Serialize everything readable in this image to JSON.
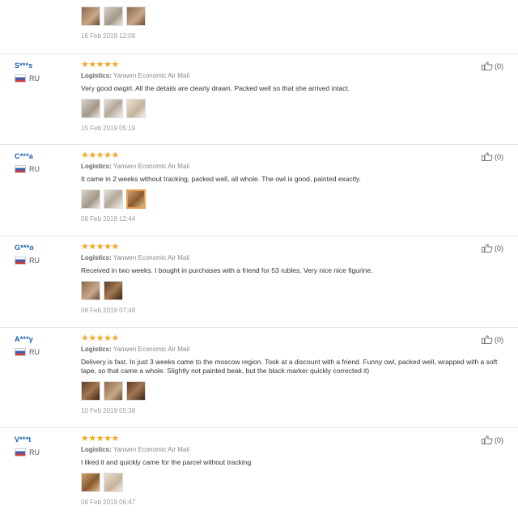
{
  "reviews": [
    {
      "user": "",
      "country": "",
      "logistics_label": "",
      "logistics_value": "",
      "text": "",
      "photos": [
        "ph-a",
        "ph-b",
        "ph-a"
      ],
      "date": "16 Feb 2019 12:09",
      "helpful": "",
      "partial": true
    },
    {
      "user": "S***s",
      "country": "RU",
      "logistics_label": "Logistics:",
      "logistics_value": "Yanwen Economic Air Mail",
      "text": "Very good owgirl. All the details are clearly drawn. Packed well so that she arrived intact.",
      "photos": [
        "ph-b",
        "ph-c",
        "ph-f"
      ],
      "date": "15 Feb 2019 05:19",
      "helpful": "(0)"
    },
    {
      "user": "C***a",
      "country": "RU",
      "logistics_label": "Logistics:",
      "logistics_value": "Yanwen Economic Air Mail",
      "text": "It came in 2 weeks without tracking, packed well, all whole. The owl is good, painted exactly.",
      "photos": [
        "ph-b",
        "ph-c",
        "ph-d"
      ],
      "selected_photo": 2,
      "date": "08 Feb 2019 12:44",
      "helpful": "(0)"
    },
    {
      "user": "G***o",
      "country": "RU",
      "logistics_label": "Logistics:",
      "logistics_value": "Yanwen Economic Air Mail",
      "text": "Received in two weeks. I bought in purchases with a friend for 53 rubles. Very nice nice figurine.",
      "photos": [
        "ph-a",
        "ph-e"
      ],
      "date": "08 Feb 2019 07:48",
      "helpful": "(0)"
    },
    {
      "user": "A***y",
      "country": "RU",
      "logistics_label": "Logistics:",
      "logistics_value": "Yanwen Economic Air Mail",
      "text": "Delivery is fast. In just 3 weeks came to the moscow region. Took at a discount with a friend. Funny owl, packed well, wrapped with a soft tape, so that came a whole. Slightly not painted beak, but the black marker quickly corrected it)",
      "photos": [
        "ph-e",
        "ph-a",
        "ph-e"
      ],
      "date": "10 Feb 2019 05:38",
      "helpful": "(0)"
    },
    {
      "user": "V***t",
      "country": "RU",
      "logistics_label": "Logistics:",
      "logistics_value": "Yanwen Economic Air Mail",
      "text": "I liked it and quickly came for the parcel without tracking",
      "photos": [
        "ph-d",
        "ph-f"
      ],
      "date": "06 Feb 2019 06:47",
      "helpful": "(0)"
    }
  ],
  "stars": "★★★★★",
  "colors": {
    "star": "#f5a623",
    "user": "#1a5fb4",
    "selected_border": "#e8a050"
  },
  "icons": {
    "helpful": "thumbs-up-icon",
    "flag": "russia-flag-icon"
  }
}
